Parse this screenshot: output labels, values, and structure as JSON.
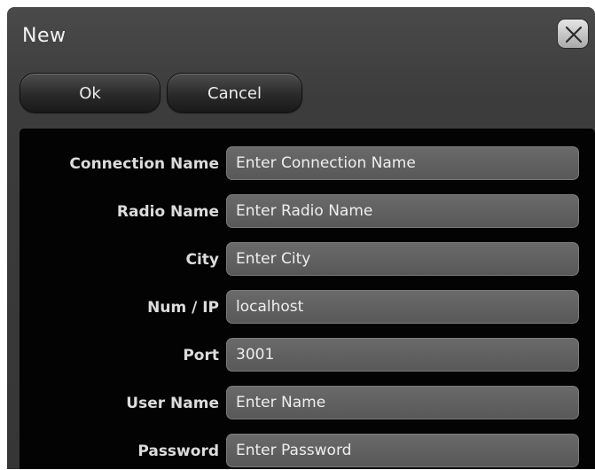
{
  "dialog": {
    "title": "New",
    "close_icon": "close-icon"
  },
  "buttons": {
    "ok_label": "Ok",
    "cancel_label": "Cancel"
  },
  "form": {
    "fields": [
      {
        "label": "Connection Name",
        "value": "Enter Connection Name"
      },
      {
        "label": "Radio Name",
        "value": "Enter Radio Name"
      },
      {
        "label": "City",
        "value": "Enter City"
      },
      {
        "label": "Num / IP",
        "value": "localhost"
      },
      {
        "label": "Port",
        "value": "3001"
      },
      {
        "label": "User Name",
        "value": "Enter Name"
      },
      {
        "label": "Password",
        "value": "Enter Password"
      }
    ]
  },
  "colors": {
    "dialog_bg": "#3c3c3c",
    "panel_bg": "#030303",
    "input_bg": "#606060",
    "text": "#dcdcdc"
  }
}
